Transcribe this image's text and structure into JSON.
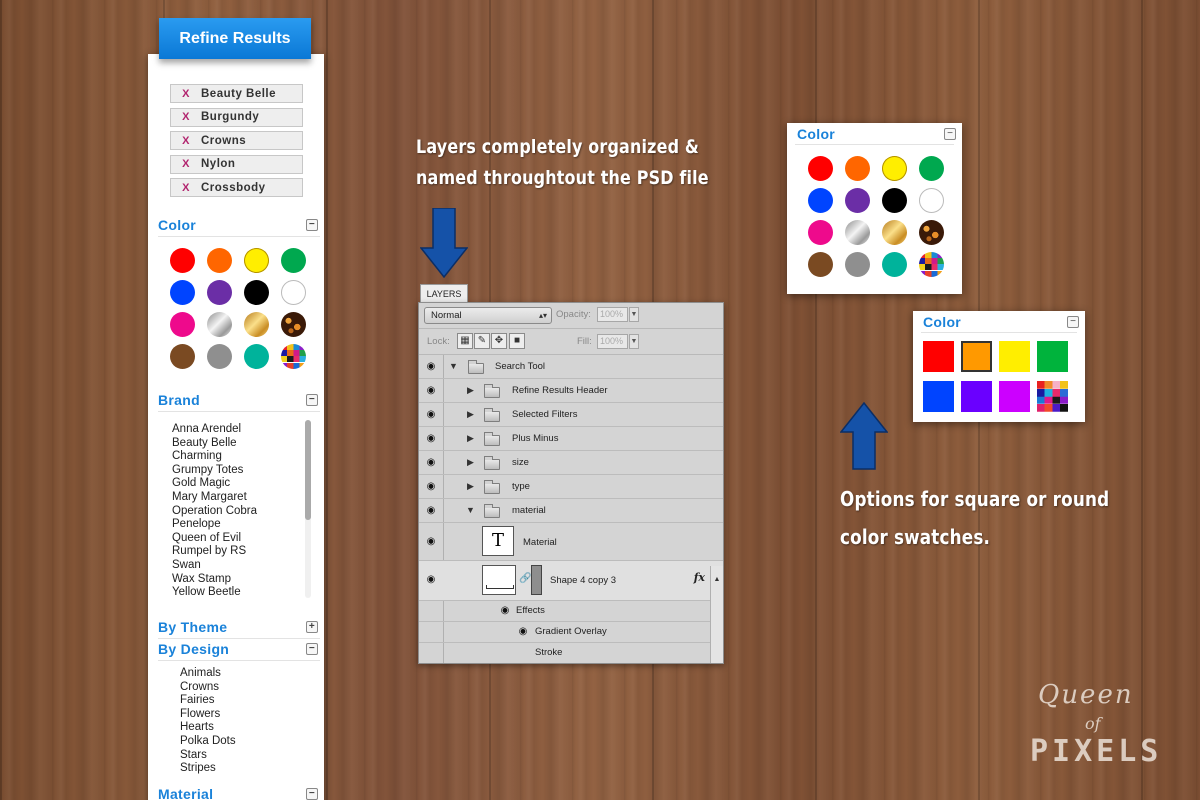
{
  "refine_header": "Refine Results",
  "selected_filters": [
    {
      "remove_label": "X",
      "label": "Beauty Belle"
    },
    {
      "remove_label": "X",
      "label": "Burgundy"
    },
    {
      "remove_label": "X",
      "label": "Crowns"
    },
    {
      "remove_label": "X",
      "label": "Nylon"
    },
    {
      "remove_label": "X",
      "label": "Crossbody"
    }
  ],
  "sections": {
    "color": {
      "title": "Color",
      "toggle": "−"
    },
    "brand": {
      "title": "Brand",
      "toggle": "−"
    },
    "by_theme": {
      "title": "By Theme",
      "toggle": "+"
    },
    "by_design": {
      "title": "By Design",
      "toggle": "−"
    },
    "material": {
      "title": "Material",
      "toggle": "−"
    }
  },
  "round_swatches": [
    {
      "name": "red",
      "color": "#ff0000"
    },
    {
      "name": "orange",
      "color": "#ff6600"
    },
    {
      "name": "yellow",
      "color": "#ffee00"
    },
    {
      "name": "green",
      "color": "#00a84f"
    },
    {
      "name": "blue",
      "color": "#0044ff"
    },
    {
      "name": "purple",
      "color": "#6b2ea6"
    },
    {
      "name": "black",
      "color": "#000000"
    },
    {
      "name": "white",
      "color": "#ffffff"
    },
    {
      "name": "pink",
      "color": "#ee0a8c"
    },
    {
      "name": "silver",
      "color": "silver-gradient"
    },
    {
      "name": "gold",
      "color": "gold-gradient"
    },
    {
      "name": "tortoise",
      "color": "tortoise-pattern"
    },
    {
      "name": "brown",
      "color": "#7a4a22"
    },
    {
      "name": "gray",
      "color": "#8f8f8f"
    },
    {
      "name": "teal",
      "color": "#00b39b"
    },
    {
      "name": "multi",
      "color": "multi-pattern"
    }
  ],
  "brands": [
    "Anna Arendel",
    "Beauty Belle",
    "Charming",
    "Grumpy Totes",
    "Gold Magic",
    "Mary Margaret",
    "Operation Cobra",
    "Penelope",
    "Queen of Evil",
    "Rumpel by RS",
    "Swan",
    "Wax Stamp",
    "Yellow Beetle"
  ],
  "designs": [
    "Animals",
    "Crowns",
    "Fairies",
    "Flowers",
    "Hearts",
    "Polka Dots",
    "Stars",
    "Stripes"
  ],
  "annotations": {
    "layers_line1": "Layers completely organized &",
    "layers_line2": "named throughtout the PSD file",
    "swatch_line1": "Options for square or round",
    "swatch_line2": "color swatches."
  },
  "layers_panel": {
    "tab": "LAYERS",
    "blend_mode": "Normal",
    "opacity_label": "Opacity:",
    "opacity_value": "100%",
    "lock_label": "Lock:",
    "fill_label": "Fill:",
    "fill_value": "100%",
    "rows": {
      "search_tool": "Search Tool",
      "refine_results_header": "Refine Results Header",
      "selected_filters": "Selected Filters",
      "plus_minus": "Plus Minus",
      "size": "size",
      "type": "type",
      "material_folder": "material",
      "material_text": "Material",
      "text_thumb": "T",
      "shape": "Shape 4 copy 3",
      "fx": "fx",
      "effects": "Effects",
      "gradient_overlay": "Gradient Overlay",
      "stroke": "Stroke"
    }
  },
  "color_panel_round": {
    "title": "Color",
    "toggle": "−"
  },
  "color_panel_square": {
    "title": "Color",
    "toggle": "−",
    "swatches": [
      {
        "name": "red",
        "color": "#ff0000"
      },
      {
        "name": "orange",
        "color": "#ff9900"
      },
      {
        "name": "yellow",
        "color": "#ffee00"
      },
      {
        "name": "green",
        "color": "#00b33c"
      },
      {
        "name": "blue",
        "color": "#0044ff"
      },
      {
        "name": "violet",
        "color": "#6a00ff"
      },
      {
        "name": "magenta",
        "color": "#cc00ff"
      },
      {
        "name": "multi",
        "color": "multi-pattern"
      }
    ]
  },
  "logo": {
    "line1": "Queen",
    "line2": "of",
    "line3": "PIXELS"
  }
}
